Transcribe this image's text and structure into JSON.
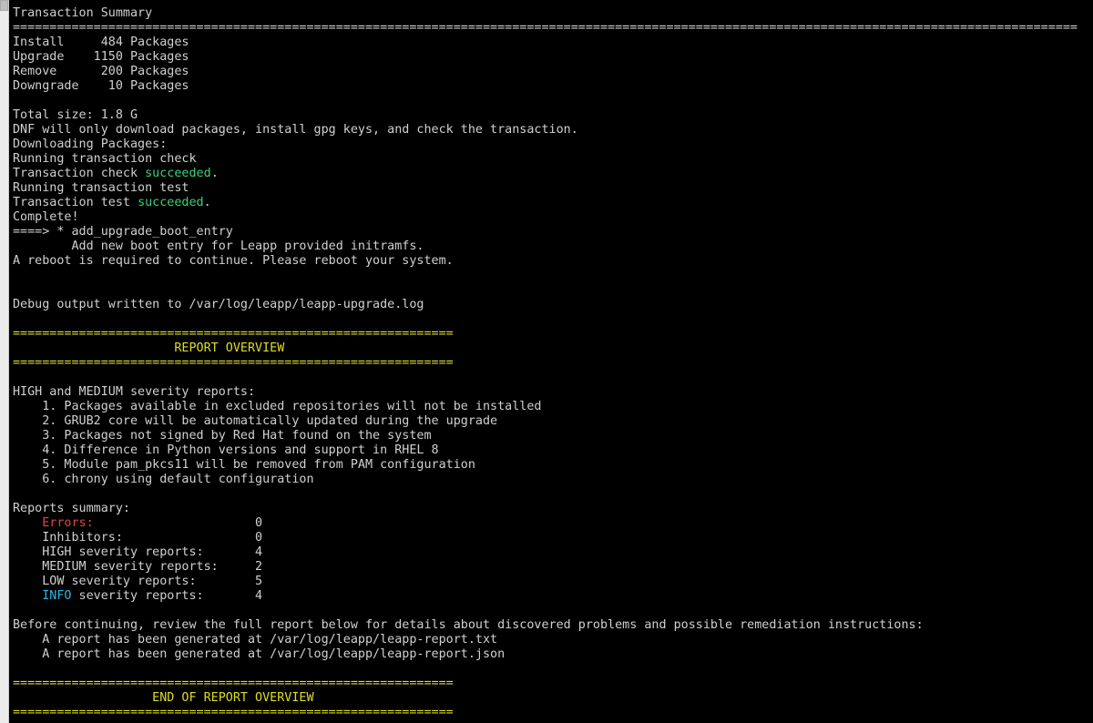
{
  "window": {
    "scrollbar_thumb": "scrollbar-thumb"
  },
  "terminal": {
    "colors": {
      "background": "#000000",
      "text": "#d0d0d0",
      "yellow": "#dcdc28",
      "green": "#3cd07a",
      "red": "#e04848",
      "cyan": "#2eb5e6"
    },
    "lines": [
      [
        {
          "t": "Transaction Summary"
        }
      ],
      [
        {
          "t": "================================================================================================================================================="
        }
      ],
      [
        {
          "t": "Install     484 Packages"
        }
      ],
      [
        {
          "t": "Upgrade    1150 Packages"
        }
      ],
      [
        {
          "t": "Remove      200 Packages"
        }
      ],
      [
        {
          "t": "Downgrade    10 Packages"
        }
      ],
      [
        {
          "t": ""
        }
      ],
      [
        {
          "t": "Total size: 1.8 G"
        }
      ],
      [
        {
          "t": "DNF will only download packages, install gpg keys, and check the transaction."
        }
      ],
      [
        {
          "t": "Downloading Packages:"
        }
      ],
      [
        {
          "t": "Running transaction check"
        }
      ],
      [
        {
          "t": "Transaction check "
        },
        {
          "t": "succeeded",
          "c": "green"
        },
        {
          "t": "."
        }
      ],
      [
        {
          "t": "Running transaction test"
        }
      ],
      [
        {
          "t": "Transaction test "
        },
        {
          "t": "succeeded",
          "c": "green"
        },
        {
          "t": "."
        }
      ],
      [
        {
          "t": "Complete!"
        }
      ],
      [
        {
          "t": "====> * add_upgrade_boot_entry"
        }
      ],
      [
        {
          "t": "        Add new boot entry for Leapp provided initramfs."
        }
      ],
      [
        {
          "t": "A reboot is required to continue. Please reboot your system."
        }
      ],
      [
        {
          "t": ""
        }
      ],
      [
        {
          "t": ""
        }
      ],
      [
        {
          "t": "Debug output written to /var/log/leapp/leapp-upgrade.log"
        }
      ],
      [
        {
          "t": ""
        }
      ],
      [
        {
          "t": "============================================================",
          "c": "yellow"
        }
      ],
      [
        {
          "t": "                      REPORT OVERVIEW",
          "c": "yellow"
        }
      ],
      [
        {
          "t": "============================================================",
          "c": "yellow"
        }
      ],
      [
        {
          "t": ""
        }
      ],
      [
        {
          "t": "HIGH and MEDIUM severity reports:"
        }
      ],
      [
        {
          "t": "    1. Packages available in excluded repositories will not be installed"
        }
      ],
      [
        {
          "t": "    2. GRUB2 core will be automatically updated during the upgrade"
        }
      ],
      [
        {
          "t": "    3. Packages not signed by Red Hat found on the system"
        }
      ],
      [
        {
          "t": "    4. Difference in Python versions and support in RHEL 8"
        }
      ],
      [
        {
          "t": "    5. Module pam_pkcs11 will be removed from PAM configuration"
        }
      ],
      [
        {
          "t": "    6. chrony using default configuration"
        }
      ],
      [
        {
          "t": ""
        }
      ],
      [
        {
          "t": "Reports summary:"
        }
      ],
      [
        {
          "t": "    "
        },
        {
          "t": "Errors:",
          "c": "red"
        },
        {
          "t": "                      0"
        }
      ],
      [
        {
          "t": "    Inhibitors:                  0"
        }
      ],
      [
        {
          "t": "    HIGH severity reports:       4"
        }
      ],
      [
        {
          "t": "    MEDIUM severity reports:     2"
        }
      ],
      [
        {
          "t": "    LOW severity reports:        5"
        }
      ],
      [
        {
          "t": "    "
        },
        {
          "t": "INFO",
          "c": "cyan"
        },
        {
          "t": " severity reports:       4"
        }
      ],
      [
        {
          "t": ""
        }
      ],
      [
        {
          "t": "Before continuing, review the full report below for details about discovered problems and possible remediation instructions:"
        }
      ],
      [
        {
          "t": "    A report has been generated at /var/log/leapp/leapp-report.txt"
        }
      ],
      [
        {
          "t": "    A report has been generated at /var/log/leapp/leapp-report.json"
        }
      ],
      [
        {
          "t": ""
        }
      ],
      [
        {
          "t": "============================================================",
          "c": "yellow"
        }
      ],
      [
        {
          "t": "                   END OF REPORT OVERVIEW",
          "c": "yellow"
        }
      ],
      [
        {
          "t": "============================================================",
          "c": "yellow"
        }
      ]
    ]
  }
}
